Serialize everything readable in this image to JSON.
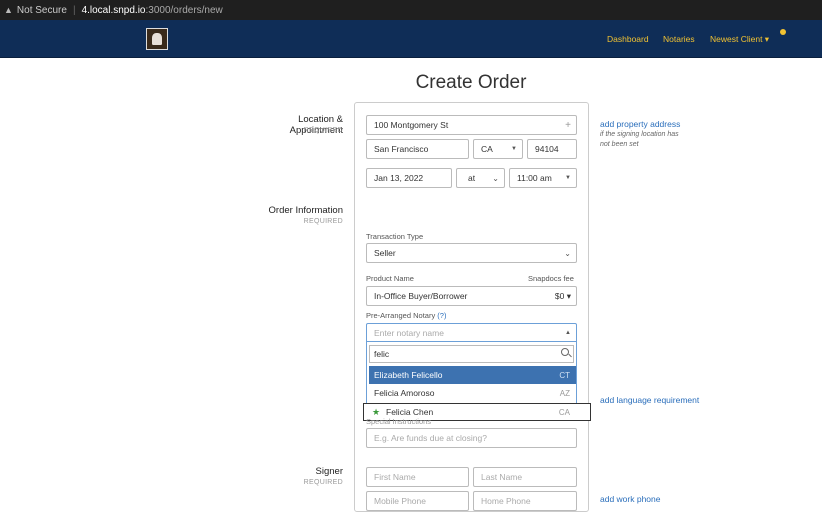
{
  "browser": {
    "security": "Not Secure",
    "host": "4.local.snpd.io",
    "path": ":3000/orders/new"
  },
  "nav": {
    "dashboard": "Dashboard",
    "notaries": "Notaries",
    "client": "Newest Client ▾"
  },
  "page": {
    "title": "Create Order"
  },
  "location": {
    "label": "Location & Appointment",
    "required": "REQUIRED",
    "address": "100 Montgomery St",
    "city": "San Francisco",
    "state": "CA",
    "zip": "94104",
    "date": "Jan 13, 2022",
    "at": "at",
    "time": "11:00 am",
    "add_property_link": "add property address",
    "note": "if the signing location has not been set"
  },
  "order": {
    "label": "Order Information",
    "required": "REQUIRED",
    "transaction_type_label": "Transaction Type",
    "transaction_type": "Seller",
    "product_name_label": "Product Name",
    "fee_label": "Snapdocs fee",
    "product_name": "In-Office Buyer/Borrower",
    "fee": "$0 ▾",
    "notary_label": "Pre-Arranged Notary",
    "notary_help": "(?)",
    "notary_placeholder": "Enter notary name",
    "notary_search": "felic",
    "options": [
      {
        "name": "Elizabeth Felicello",
        "state": "CT"
      },
      {
        "name": "Felicia Amoroso",
        "state": "AZ"
      },
      {
        "name": "Felicia Chen",
        "state": "CA"
      }
    ],
    "add_language_link": "add language requirement",
    "special_label": "Special Instructions",
    "special_placeholder": "E.g. Are funds due at closing?"
  },
  "signer": {
    "label": "Signer",
    "required": "REQUIRED",
    "first_placeholder": "First Name",
    "last_placeholder": "Last Name",
    "mobile_placeholder": "Mobile Phone",
    "home_placeholder": "Home Phone",
    "add_work_link": "add work phone"
  }
}
